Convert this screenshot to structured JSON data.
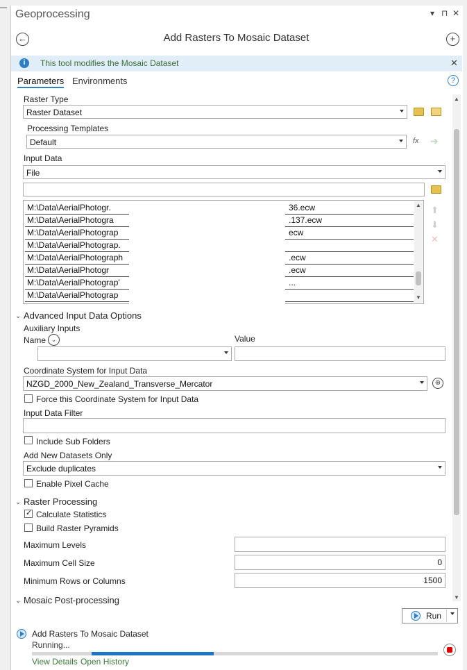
{
  "window": {
    "title": "Geoprocessing",
    "pin_glyph": "§",
    "close_glyph": "✕",
    "menu_glyph": "▾"
  },
  "tool": {
    "title": "Add Rasters To Mosaic Dataset"
  },
  "info": {
    "message": "This tool modifies the Mosaic Dataset"
  },
  "tabs": [
    "Parameters",
    "Environments"
  ],
  "params": {
    "raster_type": {
      "label": "Raster Type",
      "value": "Raster Dataset"
    },
    "processing_templates": {
      "label": "Processing Templates",
      "value": "Default"
    },
    "input_data": {
      "label": "Input Data",
      "value": "File",
      "path_value": ""
    },
    "files": [
      {
        "left": "M:\\Data\\AerialPhotogr.",
        "right": "36.ecw"
      },
      {
        "left": "M:\\Data\\AerialPhotogra",
        "right": ".137.ecw"
      },
      {
        "left": "M:\\Data\\AerialPhotograp",
        "right": "ecw"
      },
      {
        "left": "M:\\Data\\AerialPhotograp.",
        "right": ""
      },
      {
        "left": "M:\\Data\\AerialPhotograph",
        "right": ".ecw"
      },
      {
        "left": "M:\\Data\\AerialPhotogr",
        "right": ".ecw"
      },
      {
        "left": "M:\\Data\\AerialPhotograp'",
        "right": "..."
      },
      {
        "left": "M:\\Data\\AerialPhotograp",
        "right": ""
      }
    ],
    "advanced": {
      "section_label": "Advanced Input Data Options",
      "aux_label": "Auxiliary Inputs",
      "name_label": "Name",
      "value_label": "Value",
      "coord_label": "Coordinate System for Input Data",
      "coord_value": "NZGD_2000_New_Zealand_Transverse_Mercator",
      "force_coord_label": "Force this Coordinate System for Input Data",
      "filter_label": "Input Data Filter",
      "include_sub_label": "Include Sub Folders",
      "add_new_label": "Add New Datasets Only",
      "add_new_value": "Exclude duplicates",
      "pixel_cache_label": "Enable Pixel Cache"
    },
    "raster_processing": {
      "section_label": "Raster Processing",
      "calc_stats_label": "Calculate Statistics",
      "calc_stats_checked": true,
      "pyramids_label": "Build Raster Pyramids",
      "max_levels_label": "Maximum Levels",
      "max_levels_value": "",
      "max_cell_label": "Maximum Cell Size",
      "max_cell_value": "0",
      "min_rows_label": "Minimum Rows or Columns",
      "min_rows_value": "1500"
    },
    "post": {
      "section_label": "Mosaic Post-processing"
    }
  },
  "run": {
    "label": "Run"
  },
  "status": {
    "tool_name": "Add Rasters To Mosaic Dataset",
    "state": "Running...",
    "progress": 0.45,
    "view_details": "View Details",
    "open_history": "Open History"
  }
}
